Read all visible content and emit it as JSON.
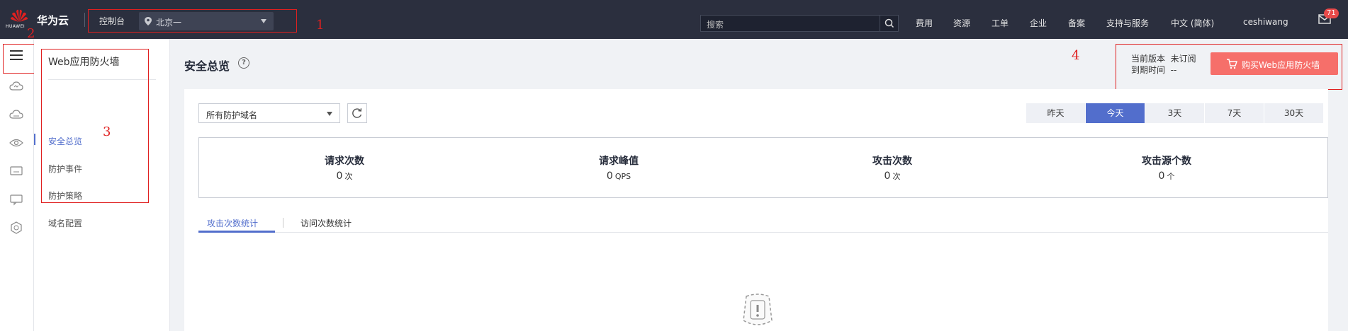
{
  "header": {
    "logo_text": "HUAWEI",
    "brand": "华为云",
    "console": "控制台",
    "region": "北京一",
    "search_placeholder": "搜索",
    "nav": [
      "费用",
      "资源",
      "工单",
      "企业",
      "备案",
      "支持与服务",
      "中文 (简体)",
      "ceshiwang"
    ],
    "mail_badge": "71",
    "brand_color": "#e02020"
  },
  "annotations": [
    "1",
    "2",
    "3",
    "4"
  ],
  "rail": {
    "icons": [
      "menu-icon",
      "cloud-icon",
      "cloud-server-icon",
      "eye-icon",
      "monitor-icon",
      "chat-icon",
      "hexagon-icon"
    ]
  },
  "submenu": {
    "title": "Web应用防火墙",
    "items": [
      {
        "label": "安全总览",
        "active": true
      },
      {
        "label": "防护事件",
        "active": false
      },
      {
        "label": "防护策略",
        "active": false
      },
      {
        "label": "域名配置",
        "active": false
      }
    ]
  },
  "main": {
    "title": "安全总览",
    "version_label": "当前版本",
    "version_value": "未订阅",
    "expire_label": "到期时间",
    "expire_value": "--",
    "buy_button": "购买Web应用防火墙",
    "domain_select": "所有防护域名",
    "time_tabs": [
      {
        "label": "昨天",
        "active": false
      },
      {
        "label": "今天",
        "active": true
      },
      {
        "label": "3天",
        "active": false
      },
      {
        "label": "7天",
        "active": false
      },
      {
        "label": "30天",
        "active": false
      }
    ],
    "stats": [
      {
        "title": "请求次数",
        "value": "0",
        "unit": "次"
      },
      {
        "title": "请求峰值",
        "value": "0",
        "unit": "QPS"
      },
      {
        "title": "攻击次数",
        "value": "0",
        "unit": "次"
      },
      {
        "title": "攻击源个数",
        "value": "0",
        "unit": "个"
      }
    ],
    "sub_tabs": [
      {
        "label": "攻击次数统计",
        "active": true
      },
      {
        "label": "访问次数统计",
        "active": false
      }
    ],
    "accent_color": "#526ecc",
    "buy_color": "#f66f6a"
  }
}
